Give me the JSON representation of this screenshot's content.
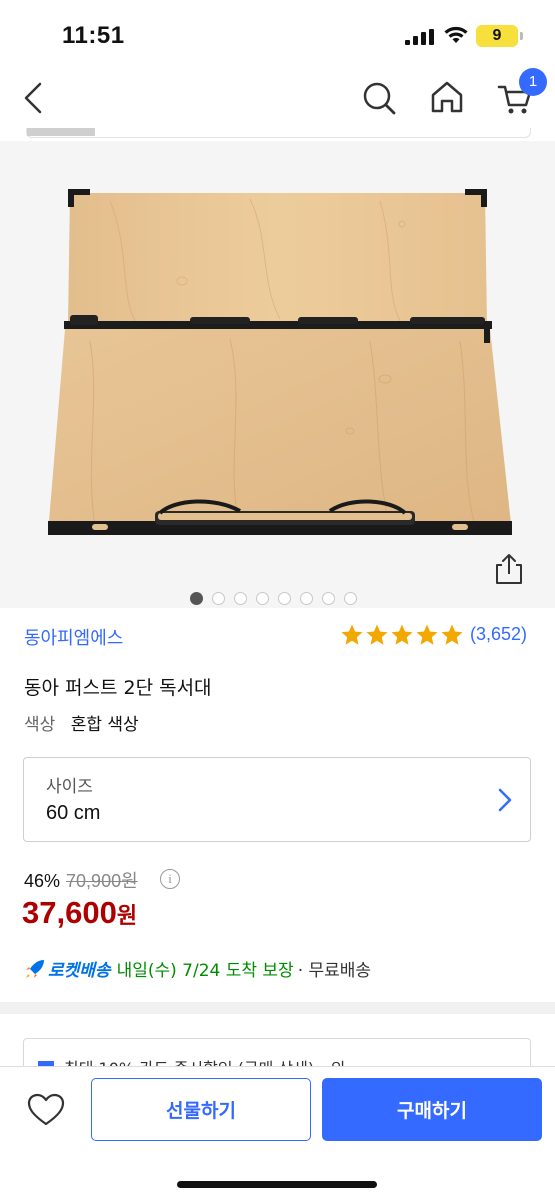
{
  "status_bar": {
    "time": "11:51",
    "battery": "9"
  },
  "nav": {
    "cart_count": "1"
  },
  "gallery": {
    "image_count": 8,
    "active_index": 0
  },
  "product": {
    "brand": "동아피엠에스",
    "rating_stars": 5,
    "review_count": "(3,652)",
    "title": "동아 퍼스트 2단 독서대",
    "color_label": "색상",
    "color_value": "혼합 색상",
    "size_label": "사이즈",
    "size_value": "60 cm",
    "discount_rate": "46%",
    "original_price": "70,900원",
    "info_icon": "i",
    "price": "37,600",
    "price_unit": "원",
    "rocket_label": "로켓배송",
    "delivery_eta": "내일(수) 7/24 도착 보장",
    "delivery_free": "· 무료배송",
    "promo_text": "최대 10% 카드 즉시할인 (구매 상세) › 의"
  },
  "actions": {
    "gift_label": "선물하기",
    "buy_label": "구매하기"
  },
  "colors": {
    "accent": "#346aff",
    "price": "#ae0000",
    "star": "#f2a800",
    "rocket": "#0073e9",
    "eta": "#008c00"
  }
}
